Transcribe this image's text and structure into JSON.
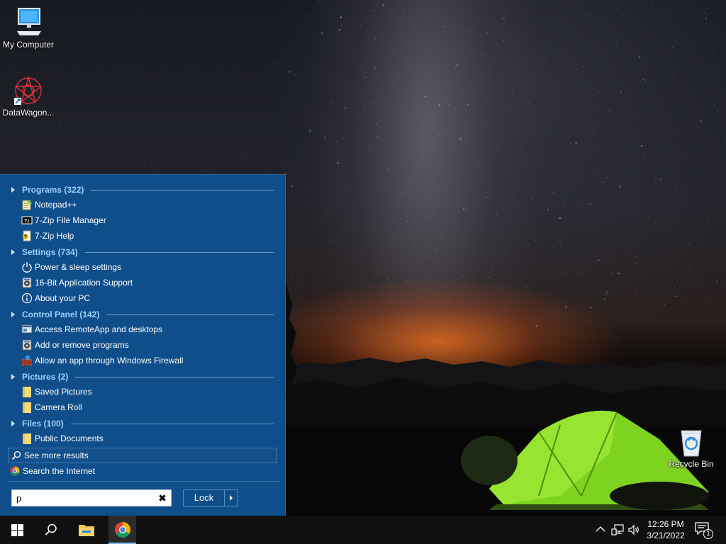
{
  "desktop": {
    "icons": [
      {
        "label": "My Computer",
        "icon": "computer-monitor-icon"
      },
      {
        "label": "DataWagon...",
        "icon": "datawagon-shortcut-icon"
      },
      {
        "label": "Recycle Bin",
        "icon": "recycle-bin-icon"
      }
    ]
  },
  "start_menu": {
    "groups": [
      {
        "label": "Programs (322)",
        "items": [
          {
            "label": "Notepad++",
            "icon": "notepad-plus-plus-icon"
          },
          {
            "label": "7-Zip File Manager",
            "icon": "7zip-icon"
          },
          {
            "label": "7-Zip Help",
            "icon": "help-file-icon"
          }
        ]
      },
      {
        "label": "Settings (734)",
        "items": [
          {
            "label": "Power & sleep settings",
            "icon": "power-icon"
          },
          {
            "label": "16-Bit Application Support",
            "icon": "program-icon"
          },
          {
            "label": "About your PC",
            "icon": "info-icon"
          }
        ]
      },
      {
        "label": "Control Panel (142)",
        "items": [
          {
            "label": "Access RemoteApp and desktops",
            "icon": "remoteapp-icon"
          },
          {
            "label": "Add or remove programs",
            "icon": "program-icon"
          },
          {
            "label": "Allow an app through Windows Firewall",
            "icon": "firewall-icon"
          }
        ]
      },
      {
        "label": "Pictures (2)",
        "items": [
          {
            "label": "Saved Pictures",
            "icon": "folder-icon"
          },
          {
            "label": "Camera Roll",
            "icon": "folder-icon"
          }
        ]
      },
      {
        "label": "Files (100)",
        "items": [
          {
            "label": "Public Documents",
            "icon": "folder-icon"
          }
        ]
      }
    ],
    "see_more": "See more results",
    "search_internet": "Search the Internet",
    "search_value": "p",
    "lock_label": "Lock"
  },
  "taskbar": {
    "time": "12:26 PM",
    "date": "3/21/2022",
    "notification_count": "1"
  },
  "colors": {
    "start_menu_bg": "#0f4e8a",
    "group_header": "#9fd0ff",
    "taskbar_bg": "#101010"
  }
}
